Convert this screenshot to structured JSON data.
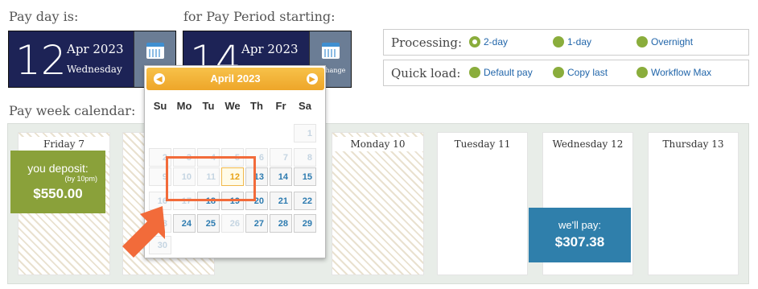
{
  "payday": {
    "label": "Pay day is:",
    "day": "12",
    "month_year": "Apr 2023",
    "weekday": "Wednesday"
  },
  "period": {
    "label": "for Pay Period starting:",
    "day": "14",
    "month_year": "Apr 2023",
    "change": "change"
  },
  "processing": {
    "label": "Processing:",
    "options": [
      "2-day",
      "1-day",
      "Overnight"
    ],
    "selected": "2-day"
  },
  "quickload": {
    "label": "Quick load:",
    "options": [
      "Default pay",
      "Copy last",
      "Workflow Max"
    ]
  },
  "week": {
    "label": "Pay week calendar:",
    "days": [
      "Friday 7",
      "Monday 10",
      "Tuesday 11",
      "Wednesday 12",
      "Thursday 13"
    ]
  },
  "deposit": {
    "title": "you deposit:",
    "note": "(by 10pm)",
    "amount": "$550.00"
  },
  "pay": {
    "title": "we'll pay:",
    "amount": "$307.38"
  },
  "calendar": {
    "title": "April 2023",
    "dow": [
      "Su",
      "Mo",
      "Tu",
      "We",
      "Th",
      "Fr",
      "Sa"
    ],
    "rows": [
      [
        "",
        "",
        "",
        "",
        "",
        "",
        "1"
      ],
      [
        "2",
        "3",
        "4",
        "5",
        "6",
        "7",
        "8"
      ],
      [
        "9",
        "10",
        "11",
        "12",
        "13",
        "14",
        "15"
      ],
      [
        "16",
        "17",
        "18",
        "19",
        "20",
        "21",
        "22"
      ],
      [
        "23",
        "24",
        "25",
        "26",
        "27",
        "28",
        "29"
      ],
      [
        "30",
        "",
        "",
        "",
        "",
        "",
        ""
      ]
    ]
  },
  "colors": {
    "navy": "#1d2356",
    "green": "#8aa13a",
    "blue": "#2f7fab",
    "orange": "#eea629",
    "highlight": "#f26b3a"
  }
}
